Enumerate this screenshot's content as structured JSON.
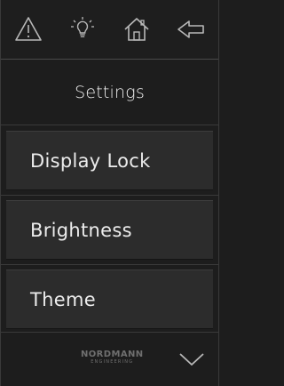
{
  "topbar": {
    "icons": [
      "warning-icon",
      "lightbulb-icon",
      "home-icon",
      "back-arrow-icon"
    ]
  },
  "page": {
    "title": "Settings"
  },
  "menu": {
    "items": [
      {
        "label": "Display Lock"
      },
      {
        "label": "Brightness"
      },
      {
        "label": "Theme"
      }
    ]
  },
  "footer": {
    "logo_line1": "NORDMANN",
    "logo_line2": "ENGINEERING",
    "scroll_icon": "chevron-down-icon"
  },
  "colors": {
    "background": "#1d1d1d",
    "button": "#2c2c2c",
    "icon": "#b8b8b8",
    "text": "#ececec"
  }
}
